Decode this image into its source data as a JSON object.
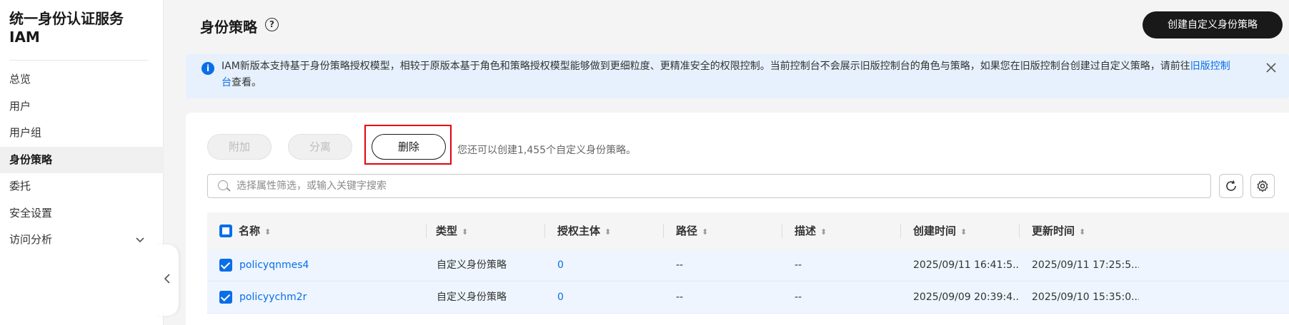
{
  "sidebar": {
    "title_line1": "统一身份认证服务",
    "title_line2": "IAM",
    "items": [
      {
        "label": "总览"
      },
      {
        "label": "用户"
      },
      {
        "label": "用户组"
      },
      {
        "label": "身份策略"
      },
      {
        "label": "委托"
      },
      {
        "label": "安全设置"
      },
      {
        "label": "访问分析"
      }
    ],
    "active_item": "身份策略"
  },
  "header": {
    "title": "身份策略",
    "create_button": "创建自定义身份策略"
  },
  "notice": {
    "text_before_link": "IAM新版本支持基于身份策略授权模型，相较于原版本基于角色和策略授权模型能够做到更细粒度、更精准安全的权限控制。当前控制台不会展示旧版控制台的角色与策略，如果您在旧版控制台创建过自定义策略，请前往",
    "link_text": "旧版控制台",
    "text_after_link": "查看。"
  },
  "toolbar": {
    "attach_label": "附加",
    "detach_label": "分离",
    "delete_label": "删除",
    "quota_text": "您还可以创建1,455个自定义身份策略。"
  },
  "search": {
    "placeholder": "选择属性筛选，或输入关键字搜索"
  },
  "table": {
    "columns": [
      "名称",
      "类型",
      "授权主体",
      "路径",
      "描述",
      "创建时间",
      "更新时间"
    ],
    "rows": [
      {
        "name": "policyqnmes4",
        "type": "自定义身份策略",
        "principals": "0",
        "path": "--",
        "description": "--",
        "created": "2025/09/11 16:41:5...",
        "updated": "2025/09/11 17:25:5..."
      },
      {
        "name": "policyychm2r",
        "type": "自定义身份策略",
        "principals": "0",
        "path": "--",
        "description": "--",
        "created": "2025/09/09 20:39:4...",
        "updated": "2025/09/10 15:35:0..."
      }
    ]
  },
  "colors": {
    "accent": "#0a6ee8",
    "primary_button": "#191919",
    "highlight": "#e60012",
    "notice_bg": "#e6f1fd",
    "row_selected_bg": "#eef5fe"
  }
}
